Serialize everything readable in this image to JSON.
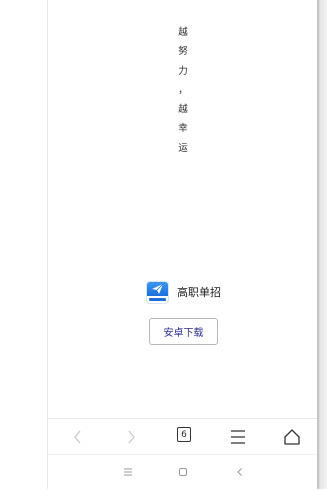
{
  "slogan": [
    "越",
    "努",
    "力",
    "，",
    "越",
    "幸",
    "运"
  ],
  "app": {
    "name": "高职单招",
    "download_label": "安卓下载"
  },
  "navbar": {
    "back_icon": "chevron-left-icon",
    "forward_icon": "chevron-right-icon",
    "tabs_count": "6",
    "menu_icon": "menu-icon",
    "home_icon": "home-icon"
  },
  "system_nav": {
    "menu_icon": "menu-icon",
    "home_icon": "square-icon",
    "back_icon": "back-icon"
  },
  "colors": {
    "accent": "#1d6fd9",
    "download_text": "#2f2f8c",
    "nav_disabled": "#c8c8c8",
    "nav_active": "#333333"
  }
}
